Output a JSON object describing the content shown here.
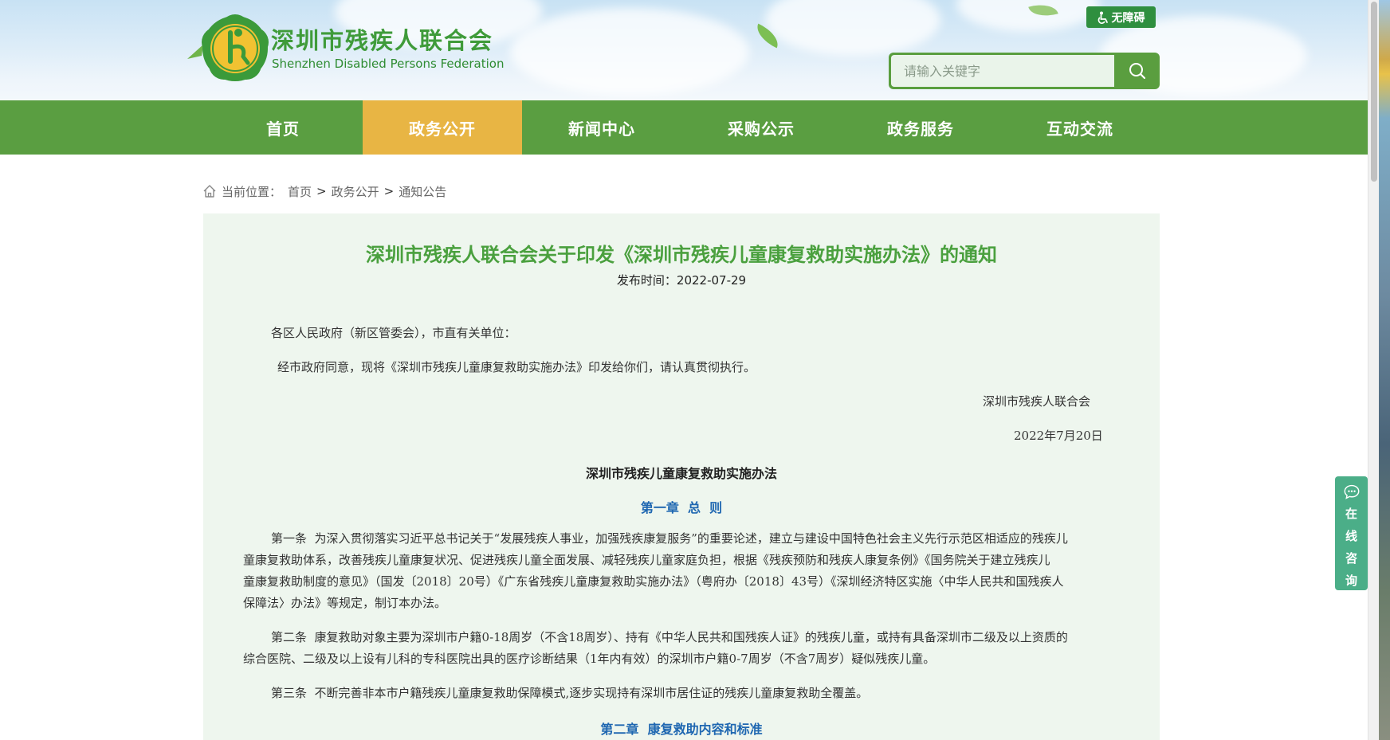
{
  "header": {
    "site_title": "深圳市残疾人联合会",
    "site_subtitle": "Shenzhen Disabled Persons Federation",
    "accessibility_label": "无障碍",
    "search_placeholder": "请输入关键字"
  },
  "nav": {
    "items": [
      {
        "label": "首页"
      },
      {
        "label": "政务公开",
        "active": true
      },
      {
        "label": "新闻中心"
      },
      {
        "label": "采购公示"
      },
      {
        "label": "政务服务"
      },
      {
        "label": "互动交流"
      }
    ]
  },
  "breadcrumb": {
    "prefix": "当前位置：",
    "items": [
      "首页",
      "政务公开",
      "通知公告"
    ],
    "separator": ">"
  },
  "article": {
    "title": "深圳市残疾人联合会关于印发《深圳市残疾儿童康复救助实施办法》的通知",
    "date_label": "发布时间：2022-07-29",
    "salutation": "各区人民政府（新区管委会），市直有关单位：",
    "intro": "经市政府同意，现将《深圳市残疾儿童康复救助实施办法》印发给你们，请认真贯彻执行。",
    "signature": "深圳市残疾人联合会",
    "sign_date": "2022年7月20日",
    "doc_title": "深圳市残疾儿童康复救助实施办法",
    "chapter1": "第一章  总  则",
    "art1_line1": "第一条  为深入贯彻落实习近平总书记关于“发展残疾人事业，加强残疾康复服务”的重要论述，建立与建设中国特色社会主义先行示范区相适应的残疾儿",
    "art1_line2": "童康复救助体系，改善残疾儿童康复状况、促进残疾儿童全面发展、减轻残疾儿童家庭负担，根据《残疾预防和残疾人康复条例》《国务院关于建立残疾儿",
    "art1_line3": "童康复救助制度的意见》（国发〔2018〕20号）《广东省残疾儿童康复救助实施办法》（粤府办〔2018〕43号）《深圳经济特区实施〈中华人民共和国残疾人",
    "art1_line4": "保障法〉办法》等规定，制订本办法。",
    "art2_line1": "第二条  康复救助对象主要为深圳市户籍0-18周岁（不含18周岁）、持有《中华人民共和国残疾人证》的残疾儿童，或持有具备深圳市二级及以上资质的",
    "art2_line2": "综合医院、二级及以上设有儿科的专科医院出具的医疗诊断结果（1年内有效）的深圳市户籍0-7周岁（不含7周岁）疑似残疾儿童。",
    "art3": "第三条  不断完善非本市户籍残疾儿童康复救助保障模式,逐步实现持有深圳市居住证的残疾儿童康复救助全覆盖。",
    "chapter2": "第二章  康复救助内容和标准"
  },
  "consult": {
    "chars": [
      "在",
      "线",
      "咨",
      "询"
    ]
  },
  "colors": {
    "brand_green": "#5a9e41",
    "active_tab": "#e8b544",
    "title_green": "#4aa03e",
    "chapter_blue": "#1f67b1",
    "consult_teal": "#4bae88"
  }
}
